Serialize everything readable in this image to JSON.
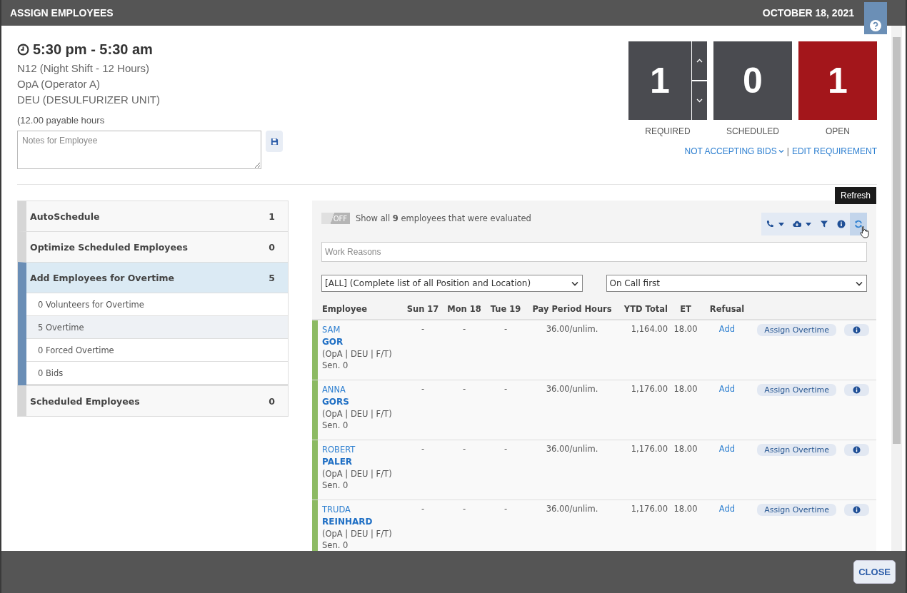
{
  "window": {
    "title": "ASSIGN EMPLOYEES",
    "date": "OCTOBER 18, 2021"
  },
  "shift": {
    "time": "5:30 pm - 5:30 am",
    "lines": [
      "N12 (Night Shift - 12 Hours)",
      "OpA (Operator A)",
      "DEU (DESULFURIZER UNIT)"
    ],
    "payable": "(12.00 payable hours",
    "notes": {
      "placeholder": "Notes for Employee"
    }
  },
  "counters": [
    {
      "kind": "stepper",
      "value": "1",
      "label": "REQUIRED"
    },
    {
      "kind": "plain",
      "value": "0",
      "label": "SCHEDULED"
    },
    {
      "kind": "alert",
      "value": "1",
      "label": "OPEN"
    }
  ],
  "link_separator": "|",
  "links": [
    {
      "label": "NOT ACCEPTING BIDS",
      "dropdown": true
    },
    {
      "label": "EDIT REQUIREMENT",
      "dropdown": false
    }
  ],
  "sidebar": {
    "items": [
      {
        "label": "AutoSchedule",
        "count": "1",
        "selected": false
      },
      {
        "label": "Optimize Scheduled Employees",
        "count": "0",
        "selected": false
      },
      {
        "label": "Add Employees for Overtime",
        "count": "5",
        "selected": true,
        "children": [
          {
            "label": "0 Volunteers for Overtime",
            "selected": false
          },
          {
            "label": "5 Overtime",
            "selected": true
          },
          {
            "label": "0 Forced Overtime",
            "selected": false
          },
          {
            "label": "0 Bids",
            "selected": false
          }
        ]
      },
      {
        "label": "Scheduled Employees",
        "count": "0",
        "selected": false
      }
    ]
  },
  "filter": {
    "toggle": {
      "label": "OFF",
      "on": false
    },
    "text": "Show all **9** employees that were evaluated",
    "tooltip": "Refresh",
    "work_reasons": {
      "placeholder": "Work Reasons"
    },
    "position_select": "[ALL] (Complete list of all Position and Location)",
    "order_select": "On Call first"
  },
  "table": {
    "columns": [
      "Employee",
      "Sun 17",
      "Mon 18",
      "Tue 19",
      "Pay Period Hours",
      "YTD Total",
      "ET",
      "Refusal"
    ],
    "rows": [
      {
        "first": "SAM",
        "last": "GOR",
        "detail": "(OpA | DEU | F/T)",
        "seniority": "Sen. 0",
        "days": [
          "-",
          "-",
          "-"
        ],
        "hours": "36.00/unlim.",
        "ytd": "1,164.00",
        "et": "18.00",
        "refusal": "Add",
        "action": "Assign Overtime"
      },
      {
        "first": "ANNA",
        "last": "GORS",
        "detail": "(OpA | DEU | F/T)",
        "seniority": "Sen. 0",
        "days": [
          "-",
          "-",
          "-"
        ],
        "hours": "36.00/unlim.",
        "ytd": "1,176.00",
        "et": "18.00",
        "refusal": "Add",
        "action": "Assign Overtime"
      },
      {
        "first": "ROBERT",
        "last": "PALER",
        "detail": "(OpA | DEU | F/T)",
        "seniority": "Sen. 0",
        "days": [
          "-",
          "-",
          "-"
        ],
        "hours": "36.00/unlim.",
        "ytd": "1,176.00",
        "et": "18.00",
        "refusal": "Add",
        "action": "Assign Overtime"
      },
      {
        "first": "TRUDA",
        "last": "REINHARD",
        "detail": "(OpA | DEU | F/T)",
        "seniority": "Sen. 0",
        "days": [
          "-",
          "-",
          "-"
        ],
        "hours": "36.00/unlim.",
        "ytd": "1,176.00",
        "et": "18.00",
        "refusal": "Add",
        "action": "Assign Overtime"
      }
    ]
  },
  "footer": {
    "close": "CLOSE"
  }
}
